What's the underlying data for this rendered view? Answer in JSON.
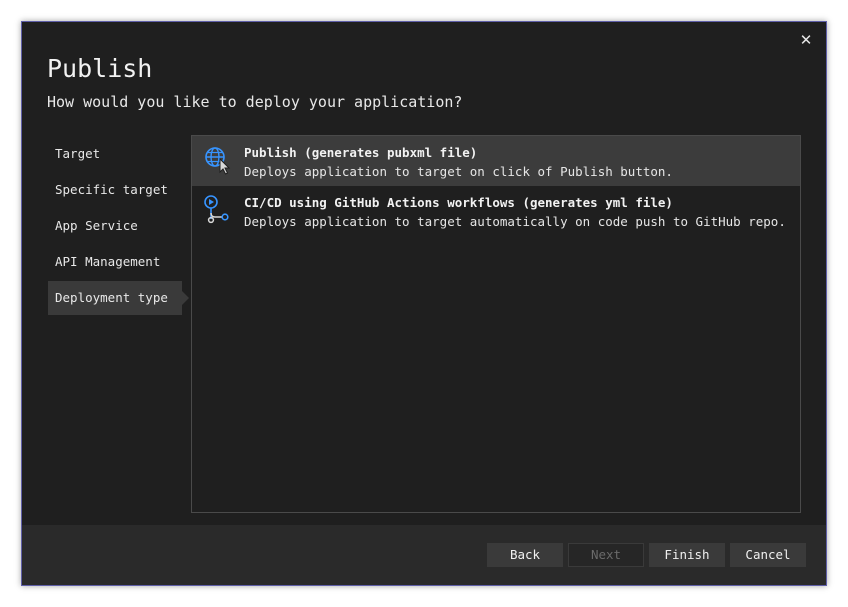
{
  "dialog": {
    "title": "Publish",
    "subtitle": "How would you like to deploy your application?",
    "close_glyph": "✕"
  },
  "steps": [
    {
      "label": "Target",
      "active": false
    },
    {
      "label": "Specific target",
      "active": false
    },
    {
      "label": "App Service",
      "active": false
    },
    {
      "label": "API Management",
      "active": false
    },
    {
      "label": "Deployment type",
      "active": true
    }
  ],
  "options": [
    {
      "icon": "globe-cursor-icon",
      "title": "Publish (generates pubxml file)",
      "description": "Deploys application to target on click of Publish button.",
      "selected": true
    },
    {
      "icon": "github-actions-workflow-icon",
      "title": "CI/CD using GitHub Actions workflows (generates yml file)",
      "description": "Deploys application to target automatically on code push to GitHub repo.",
      "selected": false
    }
  ],
  "footer": {
    "back_label": "Back",
    "next_label": "Next",
    "finish_label": "Finish",
    "cancel_label": "Cancel"
  },
  "colors": {
    "accent": "#3794ff",
    "background": "#1f1f1f",
    "border": "#5f5fa8"
  }
}
